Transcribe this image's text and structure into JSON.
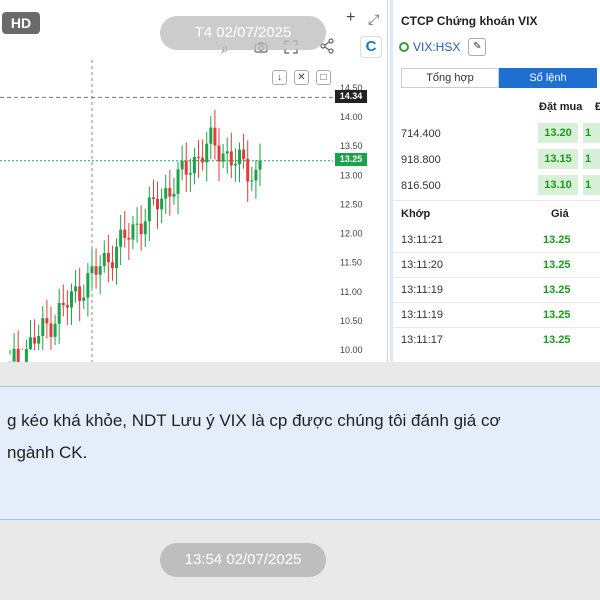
{
  "overlay": {
    "hd_badge": "HD",
    "date_pill": "T4 02/07/2025"
  },
  "chart_toolbar": {
    "add_icon": "+",
    "expand_icon": "⤢",
    "search_icon": "⌕",
    "share_icon": "share",
    "logo_letter": "C",
    "btn_down": "↓",
    "btn_close": "✕",
    "btn_window": "□"
  },
  "chart_data": {
    "type": "candlestick",
    "y_ticks": [
      "14.50",
      "14.00",
      "13.50",
      "13.00",
      "12.50",
      "12.00",
      "11.50",
      "11.00",
      "10.50",
      "10.00"
    ],
    "ylim": [
      10.0,
      14.5
    ],
    "current_price": "13.25",
    "high_marker": "14.34",
    "colors": {
      "up": "#1aa34a",
      "down": "#e33b3b",
      "price_tag": "#1aa34a",
      "high_tag": "#222222"
    }
  },
  "stock": {
    "company": "CTCP Chứng khoán VIX",
    "ticker": "VIX:HSX",
    "tabs": [
      "Tổng hợp",
      "Sổ lệnh"
    ],
    "active_tab": 1,
    "orderbook": {
      "header": "Đặt mua",
      "header_next": "Đ",
      "rows": [
        {
          "volume": "714.400",
          "price": "13.20",
          "next": "1"
        },
        {
          "volume": "918.800",
          "price": "13.15",
          "next": "1"
        },
        {
          "volume": "816.500",
          "price": "13.10",
          "next": "1"
        }
      ]
    },
    "matched": {
      "header_time": "Khớp",
      "header_price": "Giá",
      "rows": [
        {
          "time": "13:11:21",
          "price": "13.25"
        },
        {
          "time": "13:11:20",
          "price": "13.25"
        },
        {
          "time": "13:11:19",
          "price": "13.25"
        },
        {
          "time": "13:11:19",
          "price": "13.25"
        },
        {
          "time": "13:11:17",
          "price": "13.25"
        }
      ]
    }
  },
  "message": {
    "line1": "g kéo khá khỏe, NDT Lưu ý VIX là cp được chúng tôi đánh giá cơ",
    "line2": "ngành CK.",
    "time": "13:54 02/07/2025"
  }
}
